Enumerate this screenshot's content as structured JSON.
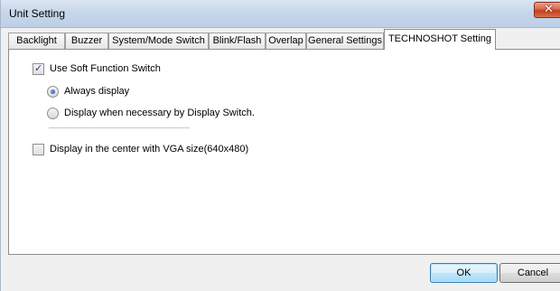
{
  "window": {
    "title": "Unit Setting",
    "close_glyph": "✕"
  },
  "tabs": [
    {
      "label": "Backlight"
    },
    {
      "label": "Buzzer"
    },
    {
      "label": "System/Mode Switch"
    },
    {
      "label": "Blink/Flash"
    },
    {
      "label": "Overlap"
    },
    {
      "label": "General Settings"
    },
    {
      "label": "TECHNOSHOT Setting"
    }
  ],
  "active_tab": "TECHNOSHOT Setting",
  "settings": {
    "use_soft_function_switch": {
      "label": "Use Soft Function Switch",
      "checked": true
    },
    "display_mode": {
      "options": [
        {
          "label": "Always display",
          "selected": true
        },
        {
          "label": "Display when necessary by Display Switch.",
          "selected": false
        }
      ]
    },
    "vga_center": {
      "label": "Display in the center with VGA size(640x480)",
      "checked": false
    }
  },
  "buttons": {
    "ok_label": "OK",
    "cancel_label": "Cancel"
  },
  "colors": {
    "titlebar": "#c7d7ea",
    "close_button": "#c3401d",
    "default_button": "#a7d9f5"
  },
  "icons": {
    "checkmark": "✓"
  }
}
